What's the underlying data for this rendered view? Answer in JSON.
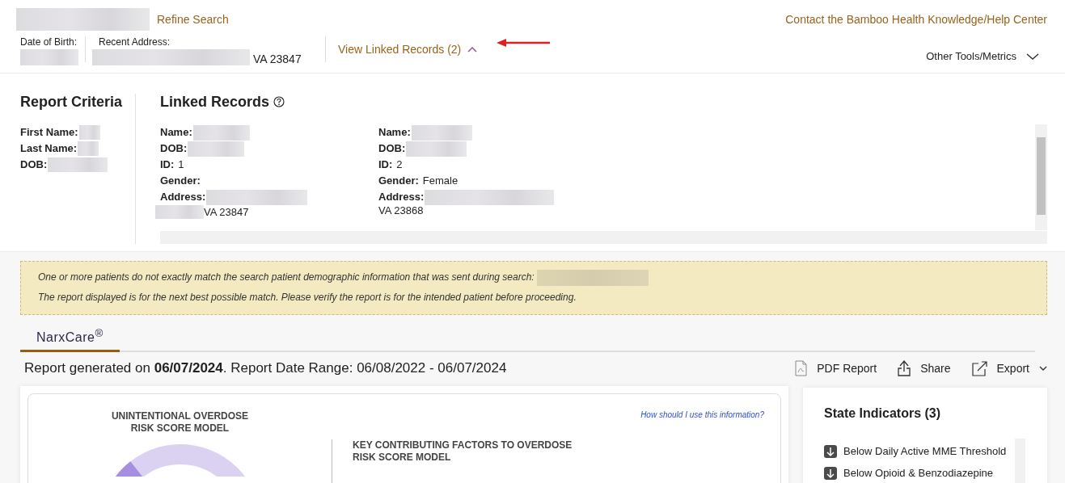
{
  "header": {
    "patient_name": {
      "redacted": true
    },
    "refine_link": "Refine Search",
    "help_link": "Contact the Bamboo Health Knowledge/Help Center",
    "dob": {
      "label": "Date of Birth:",
      "redacted": true
    },
    "address": {
      "label": "Recent Address:",
      "redacted": true,
      "value": "VA 23847"
    },
    "linked_toggle": {
      "label": "View Linked Records (2)",
      "expanded": true
    },
    "tools_menu": {
      "label": "Other Tools/Metrics",
      "expanded": false
    }
  },
  "report_criteria": {
    "title": "Report Criteria",
    "fields": [
      {
        "label": "First Name:",
        "redacted": true
      },
      {
        "label": "Last Name:",
        "redacted": true
      },
      {
        "label": "DOB:",
        "redacted": true
      }
    ]
  },
  "linked_records": {
    "title": "Linked Records",
    "records": [
      {
        "fields": [
          {
            "label": "Name:",
            "redacted": true
          },
          {
            "label": "DOB:",
            "redacted": true
          },
          {
            "label": "ID:",
            "value": "1"
          },
          {
            "label": "Gender:"
          },
          {
            "label": "Address:",
            "redacted": true,
            "continuation": {
              "redacted": true,
              "value": "VA 23847"
            }
          }
        ]
      },
      {
        "fields": [
          {
            "label": "Name:",
            "redacted": true
          },
          {
            "label": "DOB:",
            "redacted": true
          },
          {
            "label": "ID:",
            "value": "2"
          },
          {
            "label": "Gender:",
            "value": "Female"
          },
          {
            "label": "Address:",
            "redacted": true,
            "continuation": {
              "value": "VA 23868"
            }
          }
        ]
      }
    ]
  },
  "warning": {
    "lines": [
      {
        "text": "One or more patients do not exactly match the search patient demographic information that was sent during search:",
        "redacted": true
      },
      {
        "text": "The report displayed is for the next best possible match. Please verify the report is for the intended patient before proceeding."
      }
    ]
  },
  "tabs": [
    {
      "label": "NarxCare$^{®}$",
      "selected": true
    }
  ],
  "report": {
    "summary": "Report generated on **06/07/2024**. Report Date Range: 06/08/2022 - 06/07/2024",
    "actions": [
      {
        "label": "PDF Report",
        "kind": "pdf"
      },
      {
        "label": "Share",
        "kind": "share"
      },
      {
        "label": "Export",
        "kind": "export"
      }
    ]
  },
  "risk_card": {
    "title": "UNINTENTIONAL OVERDOSE RISK SCORE MODEL",
    "help_link": "How should I use this information?",
    "factors_title": "KEY CONTRIBUTING FACTORS TO OVERDOSE RISK SCORE MODEL"
  },
  "state_indicators": {
    "title": "State Indicators (3)",
    "items": [
      {
        "text": "Below Daily Active MME Threshold"
      },
      {
        "text": "Below Opioid & Benzodiazepine"
      }
    ]
  }
}
